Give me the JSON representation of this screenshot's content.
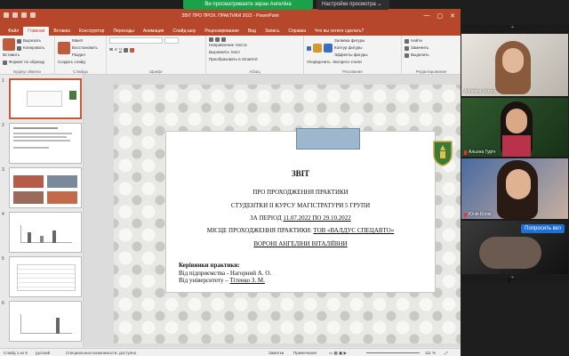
{
  "share": {
    "message": "Ви просматриваете экран Ангеліна",
    "settings_label": "Настройки просмотра"
  },
  "window": {
    "title": "ЗВІТ ПРО ПРОХ. ПРАКТИКИ 2022 - PowerPoint"
  },
  "tabs": [
    "Файл",
    "Главная",
    "Вставка",
    "Конструктор",
    "Переходы",
    "Анимация",
    "Слайд-шоу",
    "Рецензирование",
    "Вид",
    "Запись",
    "Справка",
    "Что вы хотите сделать?"
  ],
  "ribbon": {
    "clipboard": {
      "paste": "Вставить",
      "cut": "Вырезать",
      "copy": "Копировать",
      "format": "Формат по образцу",
      "name": "Буфер обмена"
    },
    "slides": {
      "new": "Создать слайд",
      "layout": "Макет",
      "reset": "Восстановить",
      "section": "Раздел",
      "name": "Слайды"
    },
    "font": {
      "name": "Шрифт"
    },
    "paragraph": {
      "name": "Абзац",
      "dir": "Направление текста",
      "align": "Выровнять текст",
      "smartart": "Преобразовать в SmartArt"
    },
    "drawing": {
      "name": "Рисование",
      "arrange": "Упорядочить",
      "styles": "Экспресс-стили",
      "fill": "Заливка фигуры",
      "outline": "Контур фигуры",
      "effects": "Эффекты фигуры"
    },
    "editing": {
      "name": "Редактирование",
      "find": "Найти",
      "replace": "Заменить",
      "select": "Выделить"
    }
  },
  "thumbnails": [
    {
      "num": "1"
    },
    {
      "num": "2"
    },
    {
      "num": "3"
    },
    {
      "num": "4"
    },
    {
      "num": "5"
    },
    {
      "num": "6"
    }
  ],
  "slide": {
    "title": "ЗВІТ",
    "line1": "ПРО ПРОХОДЖЕННЯ ПРАКТИКИ",
    "line2": "СТУДЕНТКИ ІІ КУРСУ МАГІСТРАТУРИ 5 ГРУПИ",
    "period_prefix": "ЗА ПЕРІОД ",
    "period_dates": "11.07.2022 ПО 29.10.2022",
    "place_prefix": "МІСЦЕ ПРОХОДЖЕННЯ ПРАКТИКИ: ",
    "place_name": "ТОВ «ВАЛДУС СПЕЦАВТО»",
    "student": "ВОРОНІ АНГЕЛІНИ ВІТАЛІЇВНИ",
    "heads_label": "Керівники практики:",
    "head1": "Від підприємства - Нагорний А. О.",
    "head2_prefix": "Від університету – ",
    "head2_name": "Тітенко З. М."
  },
  "status": {
    "slide_info": "Слайд 1 из 9",
    "lang": "русский",
    "accessibility": "Специальные возможности: доступно",
    "notes": "Заметки",
    "comments": "Примечания",
    "zoom": "111 %"
  },
  "participants": [
    {
      "name": "Anhelina Vorona",
      "muted": false
    },
    {
      "name": "Альона Гурїч",
      "muted": true
    },
    {
      "name": "Юлія Біляк",
      "muted": true
    },
    {
      "name": "",
      "muted": false
    }
  ],
  "ask_button": "Попросить вкл"
}
